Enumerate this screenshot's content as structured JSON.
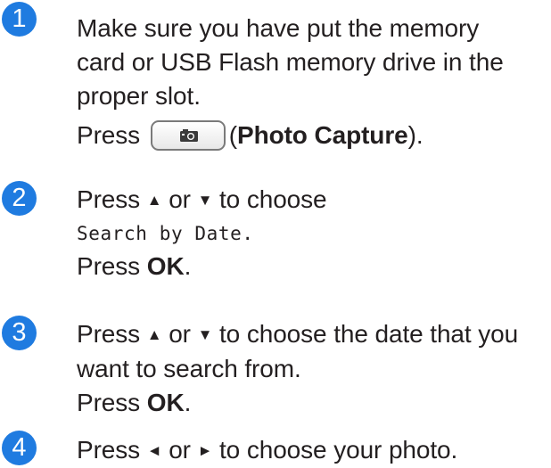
{
  "steps": [
    {
      "number": "1",
      "lines": [
        "Make sure you have put the memory",
        "card or USB Flash memory drive in the",
        "proper slot."
      ],
      "press_prefix": "Press",
      "button_label_open": "(",
      "button_label": "Photo Capture",
      "button_label_close": ")."
    },
    {
      "number": "2",
      "press": "Press",
      "or": "or",
      "to_choose": "to choose",
      "menu_option": "Search by Date.",
      "press_ok_prefix": "Press",
      "ok_label": "OK",
      "period": "."
    },
    {
      "number": "3",
      "press": "Press",
      "or": "or",
      "line1_rest": "to choose the date that you",
      "line2": "want to search from.",
      "press_ok_prefix": "Press",
      "ok_label": "OK",
      "period": "."
    },
    {
      "number": "4",
      "press": "Press",
      "or": "or",
      "rest": "to choose your photo."
    }
  ],
  "icons": {
    "up": "▲",
    "down": "▼",
    "left": "◄",
    "right": "►",
    "camera": "camera-icon"
  },
  "colors": {
    "step_badge": "#1f7be0",
    "text": "#231f20"
  }
}
